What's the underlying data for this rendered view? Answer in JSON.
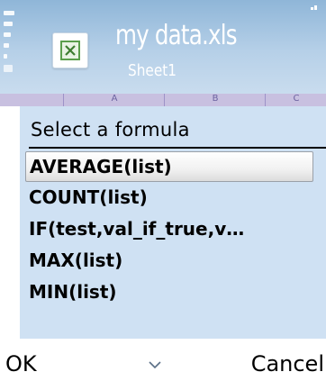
{
  "window": {
    "title": "my data.xls",
    "subtitle": "Sheet1",
    "app_icon": "excel-file-icon"
  },
  "columns": [
    "A",
    "B",
    "C"
  ],
  "dialog": {
    "title": "Select a formula",
    "items": [
      {
        "label": "AVERAGE(list)",
        "selected": true
      },
      {
        "label": "COUNT(list)",
        "selected": false
      },
      {
        "label": "IF(test,val_if_true,v…",
        "selected": false
      },
      {
        "label": "MAX(list)",
        "selected": false
      },
      {
        "label": "MIN(list)",
        "selected": false
      }
    ]
  },
  "softkeys": {
    "left": "OK",
    "middle_icon": "chevron-down-icon",
    "right": "Cancel"
  },
  "colors": {
    "dialog_background": "#cfe1f3",
    "titlebar_background": "#b6d0e8"
  }
}
